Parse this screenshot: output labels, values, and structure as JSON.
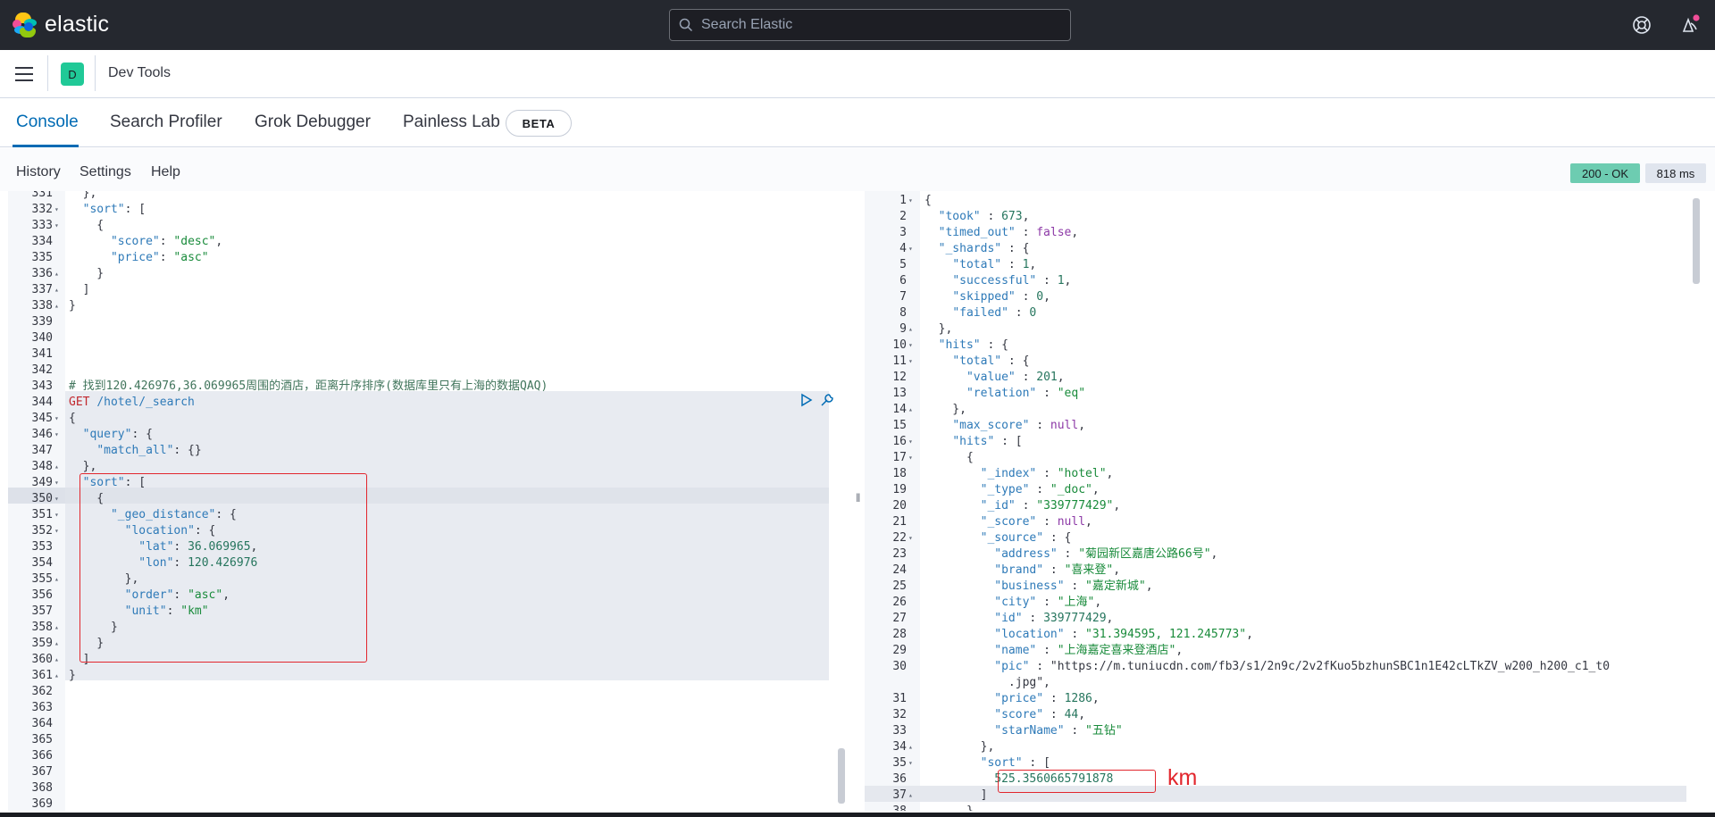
{
  "topbar": {
    "logo_text": "elastic",
    "search_placeholder": "Search Elastic",
    "help_icon": "lifebuoy-icon",
    "news_icon": "newsfeed-icon"
  },
  "header": {
    "space_initial": "D",
    "breadcrumb": "Dev Tools"
  },
  "tabs": [
    {
      "label": "Console",
      "active": true
    },
    {
      "label": "Search Profiler",
      "active": false
    },
    {
      "label": "Grok Debugger",
      "active": false
    },
    {
      "label": "Painless Lab",
      "active": false
    }
  ],
  "beta_badge": "BETA",
  "menu": [
    "History",
    "Settings",
    "Help"
  ],
  "status": {
    "code": "200 - OK",
    "time": "818 ms"
  },
  "annotation": {
    "km": "km"
  },
  "colors": {
    "accent": "#006bb4",
    "status_ok": "#6dccb1",
    "annotation": "#e2262d"
  },
  "request_lines": [
    {
      "n": "331",
      "fold": "",
      "code": "  },"
    },
    {
      "n": "332",
      "fold": "▾",
      "code": "  \"sort\": ["
    },
    {
      "n": "333",
      "fold": "▾",
      "code": "    {"
    },
    {
      "n": "334",
      "fold": "",
      "code": "      \"score\": \"desc\","
    },
    {
      "n": "335",
      "fold": "",
      "code": "      \"price\": \"asc\""
    },
    {
      "n": "336",
      "fold": "▴",
      "code": "    }"
    },
    {
      "n": "337",
      "fold": "▴",
      "code": "  ]"
    },
    {
      "n": "338",
      "fold": "▴",
      "code": "}"
    },
    {
      "n": "339",
      "fold": "",
      "code": ""
    },
    {
      "n": "340",
      "fold": "",
      "code": ""
    },
    {
      "n": "341",
      "fold": "",
      "code": ""
    },
    {
      "n": "342",
      "fold": "",
      "code": ""
    },
    {
      "n": "343",
      "fold": "",
      "code": "# 找到120.426976,36.069965周围的酒店，距离升序排序(数据库里只有上海的数据QAQ)"
    },
    {
      "n": "344",
      "fold": "",
      "code": "GET /hotel/_search"
    },
    {
      "n": "345",
      "fold": "▾",
      "code": "{"
    },
    {
      "n": "346",
      "fold": "▾",
      "code": "  \"query\": {"
    },
    {
      "n": "347",
      "fold": "",
      "code": "    \"match_all\": {}"
    },
    {
      "n": "348",
      "fold": "▴",
      "code": "  },"
    },
    {
      "n": "349",
      "fold": "▾",
      "code": "  \"sort\": ["
    },
    {
      "n": "350",
      "fold": "▾",
      "code": "    {"
    },
    {
      "n": "351",
      "fold": "▾",
      "code": "      \"_geo_distance\": {"
    },
    {
      "n": "352",
      "fold": "▾",
      "code": "        \"location\": {"
    },
    {
      "n": "353",
      "fold": "",
      "code": "          \"lat\": 36.069965,"
    },
    {
      "n": "354",
      "fold": "",
      "code": "          \"lon\": 120.426976"
    },
    {
      "n": "355",
      "fold": "▴",
      "code": "        },"
    },
    {
      "n": "356",
      "fold": "",
      "code": "        \"order\": \"asc\","
    },
    {
      "n": "357",
      "fold": "",
      "code": "        \"unit\": \"km\""
    },
    {
      "n": "358",
      "fold": "▴",
      "code": "      }"
    },
    {
      "n": "359",
      "fold": "▴",
      "code": "    }"
    },
    {
      "n": "360",
      "fold": "▴",
      "code": "  ]"
    },
    {
      "n": "361",
      "fold": "▴",
      "code": "}"
    },
    {
      "n": "362",
      "fold": "",
      "code": ""
    },
    {
      "n": "363",
      "fold": "",
      "code": ""
    },
    {
      "n": "364",
      "fold": "",
      "code": ""
    },
    {
      "n": "365",
      "fold": "",
      "code": ""
    },
    {
      "n": "366",
      "fold": "",
      "code": ""
    },
    {
      "n": "367",
      "fold": "",
      "code": ""
    },
    {
      "n": "368",
      "fold": "",
      "code": ""
    },
    {
      "n": "369",
      "fold": "",
      "code": ""
    }
  ],
  "response_lines": [
    {
      "n": "1",
      "fold": "▾",
      "code": "{"
    },
    {
      "n": "2",
      "fold": "",
      "code": "  \"took\" : 673,"
    },
    {
      "n": "3",
      "fold": "",
      "code": "  \"timed_out\" : false,"
    },
    {
      "n": "4",
      "fold": "▾",
      "code": "  \"_shards\" : {"
    },
    {
      "n": "5",
      "fold": "",
      "code": "    \"total\" : 1,"
    },
    {
      "n": "6",
      "fold": "",
      "code": "    \"successful\" : 1,"
    },
    {
      "n": "7",
      "fold": "",
      "code": "    \"skipped\" : 0,"
    },
    {
      "n": "8",
      "fold": "",
      "code": "    \"failed\" : 0"
    },
    {
      "n": "9",
      "fold": "▴",
      "code": "  },"
    },
    {
      "n": "10",
      "fold": "▾",
      "code": "  \"hits\" : {"
    },
    {
      "n": "11",
      "fold": "▾",
      "code": "    \"total\" : {"
    },
    {
      "n": "12",
      "fold": "",
      "code": "      \"value\" : 201,"
    },
    {
      "n": "13",
      "fold": "",
      "code": "      \"relation\" : \"eq\""
    },
    {
      "n": "14",
      "fold": "▴",
      "code": "    },"
    },
    {
      "n": "15",
      "fold": "",
      "code": "    \"max_score\" : null,"
    },
    {
      "n": "16",
      "fold": "▾",
      "code": "    \"hits\" : ["
    },
    {
      "n": "17",
      "fold": "▾",
      "code": "      {"
    },
    {
      "n": "18",
      "fold": "",
      "code": "        \"_index\" : \"hotel\","
    },
    {
      "n": "19",
      "fold": "",
      "code": "        \"_type\" : \"_doc\","
    },
    {
      "n": "20",
      "fold": "",
      "code": "        \"_id\" : \"339777429\","
    },
    {
      "n": "21",
      "fold": "",
      "code": "        \"_score\" : null,"
    },
    {
      "n": "22",
      "fold": "▾",
      "code": "        \"_source\" : {"
    },
    {
      "n": "23",
      "fold": "",
      "code": "          \"address\" : \"菊园新区嘉唐公路66号\","
    },
    {
      "n": "24",
      "fold": "",
      "code": "          \"brand\" : \"喜来登\","
    },
    {
      "n": "25",
      "fold": "",
      "code": "          \"business\" : \"嘉定新城\","
    },
    {
      "n": "26",
      "fold": "",
      "code": "          \"city\" : \"上海\","
    },
    {
      "n": "27",
      "fold": "",
      "code": "          \"id\" : 339777429,"
    },
    {
      "n": "28",
      "fold": "",
      "code": "          \"location\" : \"31.394595, 121.245773\","
    },
    {
      "n": "29",
      "fold": "",
      "code": "          \"name\" : \"上海嘉定喜来登酒店\","
    },
    {
      "n": "30",
      "fold": "",
      "code": "          \"pic\" : \"https://m.tuniucdn.com/fb3/s1/2n9c/2v2fKuo5bzhunSBC1n1E42cLTkZV_w200_h200_c1_t0"
    },
    {
      "n": "",
      "fold": "",
      "code": "            .jpg\","
    },
    {
      "n": "31",
      "fold": "",
      "code": "          \"price\" : 1286,"
    },
    {
      "n": "32",
      "fold": "",
      "code": "          \"score\" : 44,"
    },
    {
      "n": "33",
      "fold": "",
      "code": "          \"starName\" : \"五钻\""
    },
    {
      "n": "34",
      "fold": "▴",
      "code": "        },"
    },
    {
      "n": "35",
      "fold": "▾",
      "code": "        \"sort\" : ["
    },
    {
      "n": "36",
      "fold": "",
      "code": "          525.3560665791878"
    },
    {
      "n": "37",
      "fold": "▴",
      "code": "        ]"
    },
    {
      "n": "38",
      "fold": "",
      "code": "      }"
    }
  ]
}
